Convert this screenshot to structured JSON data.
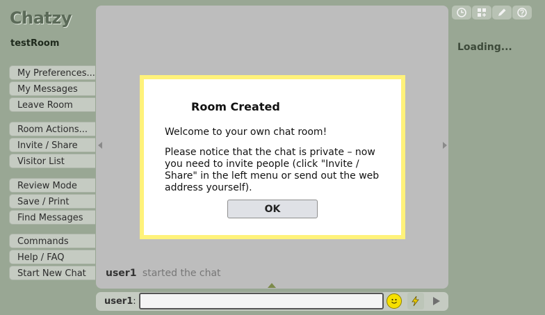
{
  "app": {
    "logo": "Chatzy",
    "room_name": "testRoom",
    "status": "Loading..."
  },
  "menu": {
    "group1": [
      {
        "label": "My Preferences...",
        "name": "menu-my-preferences"
      },
      {
        "label": "My Messages",
        "name": "menu-my-messages"
      },
      {
        "label": "Leave Room",
        "name": "menu-leave-room"
      }
    ],
    "group2": [
      {
        "label": "Room Actions...",
        "name": "menu-room-actions"
      },
      {
        "label": "Invite / Share",
        "name": "menu-invite-share"
      },
      {
        "label": "Visitor List",
        "name": "menu-visitor-list"
      }
    ],
    "group3": [
      {
        "label": "Review Mode",
        "name": "menu-review-mode"
      },
      {
        "label": "Save / Print",
        "name": "menu-save-print"
      },
      {
        "label": "Find Messages",
        "name": "menu-find-messages"
      }
    ],
    "group4": [
      {
        "label": "Commands",
        "name": "menu-commands"
      },
      {
        "label": "Help / FAQ",
        "name": "menu-help-faq"
      },
      {
        "label": "Start New Chat",
        "name": "menu-start-new-chat"
      }
    ]
  },
  "chat": {
    "messages": [
      {
        "user": "user1",
        "text": "started the chat"
      }
    ]
  },
  "input": {
    "user_label": "user1",
    "colon": ":",
    "value": ""
  },
  "toolbar": {
    "icons": [
      "clock-icon",
      "grid-icon",
      "pencil-icon",
      "help-icon"
    ]
  },
  "dialog": {
    "title": "Room Created",
    "paragraph1": "Welcome to your own chat room!",
    "paragraph2": "Please notice that the chat is private – now you need to invite people (click \"Invite / Share\" in the left menu or send out the web address yourself).",
    "ok_label": "OK"
  },
  "colors": {
    "background": "#99a794",
    "dialog_border": "#fff27a",
    "panel": "#bdbdbd",
    "smiley": "#f6e000"
  }
}
